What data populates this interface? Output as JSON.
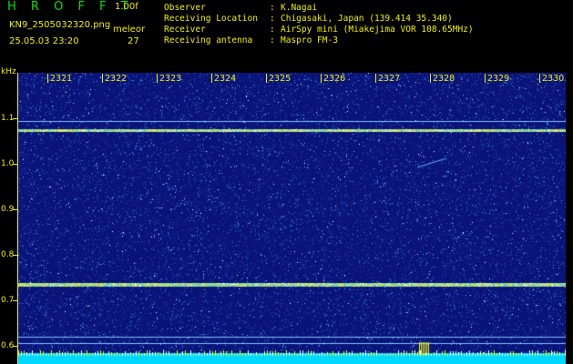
{
  "header": {
    "app_title": "H R O F F T",
    "app_version": "1.00f",
    "file_name": "KN9_2505032320.png",
    "mode_label": "meleor",
    "datetime": "25.05.03 23:20",
    "count": "27"
  },
  "station_info": [
    {
      "key": "Observer",
      "sep": ":",
      "value": "K.Nagai"
    },
    {
      "key": "Receiving Location",
      "sep": ":",
      "value": "Chigasaki, Japan (139.414 35.340)"
    },
    {
      "key": "Receiver",
      "sep": ":",
      "value": "AirSpy mini (Miakejima VOR 108.65MHz)"
    },
    {
      "key": "Receiving antenna",
      "sep": ":",
      "value": "Maspro FM-3"
    }
  ],
  "spectrogram": {
    "frequency_unit": "kHz",
    "frequency_ticks": [
      "1.1",
      "1.0",
      "0.9",
      "0.8",
      "0.7",
      "0.6"
    ],
    "time_ticks": [
      "2321",
      "2322",
      "2323",
      "2324",
      "2325",
      "2326",
      "2327",
      "2328",
      "2329",
      "2330"
    ],
    "colors": {
      "background": "#0a1478",
      "noise": "#2f6be0",
      "signal": "#e8e040",
      "floor": "#00d8ff",
      "burst": "#ffff00"
    }
  }
}
